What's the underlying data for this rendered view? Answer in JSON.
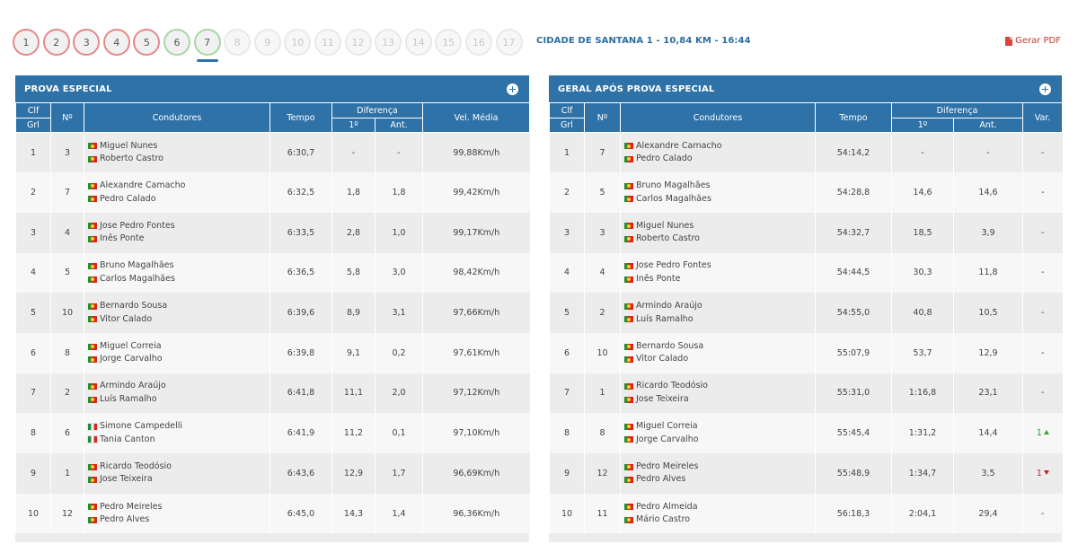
{
  "stages": [
    {
      "label": "1",
      "state": "done"
    },
    {
      "label": "2",
      "state": "done"
    },
    {
      "label": "3",
      "state": "done"
    },
    {
      "label": "4",
      "state": "done"
    },
    {
      "label": "5",
      "state": "done"
    },
    {
      "label": "6",
      "state": "green"
    },
    {
      "label": "7",
      "state": "green active"
    },
    {
      "label": "8",
      "state": ""
    },
    {
      "label": "9",
      "state": ""
    },
    {
      "label": "10",
      "state": ""
    },
    {
      "label": "11",
      "state": ""
    },
    {
      "label": "12",
      "state": ""
    },
    {
      "label": "13",
      "state": ""
    },
    {
      "label": "14",
      "state": ""
    },
    {
      "label": "15",
      "state": ""
    },
    {
      "label": "16",
      "state": ""
    },
    {
      "label": "17",
      "state": ""
    }
  ],
  "stage_info": "CIDADE DE SANTANA 1 - 10,84 KM - 16:44",
  "pdf_label": "Gerar PDF",
  "colors": {
    "accent": "#2f72a8",
    "up": "#32a532",
    "down": "#c0212c"
  },
  "stage_panel": {
    "title": "PROVA ESPECIAL",
    "headers": {
      "clf": "Clf",
      "grl": "Grl",
      "no": "Nº",
      "drivers": "Condutores",
      "time": "Tempo",
      "diff": "Diferença",
      "first": "1º",
      "prev": "Ant.",
      "speed": "Vel. Média"
    },
    "rows": [
      {
        "pos": "1",
        "no": "3",
        "d1": "Miguel Nunes",
        "f1": "pt",
        "d2": "Roberto Castro",
        "f2": "pt",
        "time": "6:30,7",
        "first": "-",
        "prev": "-",
        "speed": "99,88Km/h"
      },
      {
        "pos": "2",
        "no": "7",
        "d1": "Alexandre Camacho",
        "f1": "pt",
        "d2": "Pedro Calado",
        "f2": "pt",
        "time": "6:32,5",
        "first": "1,8",
        "prev": "1,8",
        "speed": "99,42Km/h"
      },
      {
        "pos": "3",
        "no": "4",
        "d1": "Jose Pedro Fontes",
        "f1": "pt",
        "d2": "Inês Ponte",
        "f2": "pt",
        "time": "6:33,5",
        "first": "2,8",
        "prev": "1,0",
        "speed": "99,17Km/h"
      },
      {
        "pos": "4",
        "no": "5",
        "d1": "Bruno Magalhães",
        "f1": "pt",
        "d2": "Carlos Magalhães",
        "f2": "pt",
        "time": "6:36,5",
        "first": "5,8",
        "prev": "3,0",
        "speed": "98,42Km/h"
      },
      {
        "pos": "5",
        "no": "10",
        "d1": "Bernardo Sousa",
        "f1": "pt",
        "d2": "Vitor Calado",
        "f2": "pt",
        "time": "6:39,6",
        "first": "8,9",
        "prev": "3,1",
        "speed": "97,66Km/h"
      },
      {
        "pos": "6",
        "no": "8",
        "d1": "Miguel Correia",
        "f1": "pt",
        "d2": "Jorge Carvalho",
        "f2": "pt",
        "time": "6:39,8",
        "first": "9,1",
        "prev": "0,2",
        "speed": "97,61Km/h"
      },
      {
        "pos": "7",
        "no": "2",
        "d1": "Armindo Araújo",
        "f1": "pt",
        "d2": "Luís Ramalho",
        "f2": "pt",
        "time": "6:41,8",
        "first": "11,1",
        "prev": "2,0",
        "speed": "97,12Km/h"
      },
      {
        "pos": "8",
        "no": "6",
        "d1": "Simone Campedelli",
        "f1": "it",
        "d2": "Tania Canton",
        "f2": "it",
        "time": "6:41,9",
        "first": "11,2",
        "prev": "0,1",
        "speed": "97,10Km/h"
      },
      {
        "pos": "9",
        "no": "1",
        "d1": "Ricardo Teodósio",
        "f1": "pt",
        "d2": "Jose Teixeira",
        "f2": "pt",
        "time": "6:43,6",
        "first": "12,9",
        "prev": "1,7",
        "speed": "96,69Km/h"
      },
      {
        "pos": "10",
        "no": "12",
        "d1": "Pedro Meireles",
        "f1": "pt",
        "d2": "Pedro Alves",
        "f2": "pt",
        "time": "6:45,0",
        "first": "14,3",
        "prev": "1,4",
        "speed": "96,36Km/h"
      }
    ]
  },
  "overall_panel": {
    "title": "GERAL APÓS PROVA ESPECIAL",
    "headers": {
      "clf": "Clf",
      "grl": "Grl",
      "no": "Nº",
      "drivers": "Condutores",
      "time": "Tempo",
      "diff": "Diferença",
      "first": "1º",
      "prev": "Ant.",
      "var": "Var."
    },
    "rows": [
      {
        "pos": "1",
        "no": "7",
        "d1": "Alexandre Camacho",
        "f1": "pt",
        "d2": "Pedro Calado",
        "f2": "pt",
        "time": "54:14,2",
        "first": "-",
        "prev": "-",
        "var": "-",
        "dir": ""
      },
      {
        "pos": "2",
        "no": "5",
        "d1": "Bruno Magalhães",
        "f1": "pt",
        "d2": "Carlos Magalhães",
        "f2": "pt",
        "time": "54:28,8",
        "first": "14,6",
        "prev": "14,6",
        "var": "-",
        "dir": ""
      },
      {
        "pos": "3",
        "no": "3",
        "d1": "Miguel Nunes",
        "f1": "pt",
        "d2": "Roberto Castro",
        "f2": "pt",
        "time": "54:32,7",
        "first": "18,5",
        "prev": "3,9",
        "var": "-",
        "dir": ""
      },
      {
        "pos": "4",
        "no": "4",
        "d1": "Jose Pedro Fontes",
        "f1": "pt",
        "d2": "Inês Ponte",
        "f2": "pt",
        "time": "54:44,5",
        "first": "30,3",
        "prev": "11,8",
        "var": "-",
        "dir": ""
      },
      {
        "pos": "5",
        "no": "2",
        "d1": "Armindo Araújo",
        "f1": "pt",
        "d2": "Luís Ramalho",
        "f2": "pt",
        "time": "54:55,0",
        "first": "40,8",
        "prev": "10,5",
        "var": "-",
        "dir": ""
      },
      {
        "pos": "6",
        "no": "10",
        "d1": "Bernardo Sousa",
        "f1": "pt",
        "d2": "Vitor Calado",
        "f2": "pt",
        "time": "55:07,9",
        "first": "53,7",
        "prev": "12,9",
        "var": "-",
        "dir": ""
      },
      {
        "pos": "7",
        "no": "1",
        "d1": "Ricardo Teodósio",
        "f1": "pt",
        "d2": "Jose Teixeira",
        "f2": "pt",
        "time": "55:31,0",
        "first": "1:16,8",
        "prev": "23,1",
        "var": "-",
        "dir": ""
      },
      {
        "pos": "8",
        "no": "8",
        "d1": "Miguel Correia",
        "f1": "pt",
        "d2": "Jorge Carvalho",
        "f2": "pt",
        "time": "55:45,4",
        "first": "1:31,2",
        "prev": "14,4",
        "var": "1",
        "dir": "up"
      },
      {
        "pos": "9",
        "no": "12",
        "d1": "Pedro Meireles",
        "f1": "pt",
        "d2": "Pedro Alves",
        "f2": "pt",
        "time": "55:48,9",
        "first": "1:34,7",
        "prev": "3,5",
        "var": "1",
        "dir": "down"
      },
      {
        "pos": "10",
        "no": "11",
        "d1": "Pedro Almeida",
        "f1": "pt",
        "d2": "Mário Castro",
        "f2": "pt",
        "time": "56:18,3",
        "first": "2:04,1",
        "prev": "29,4",
        "var": "-",
        "dir": ""
      }
    ]
  }
}
